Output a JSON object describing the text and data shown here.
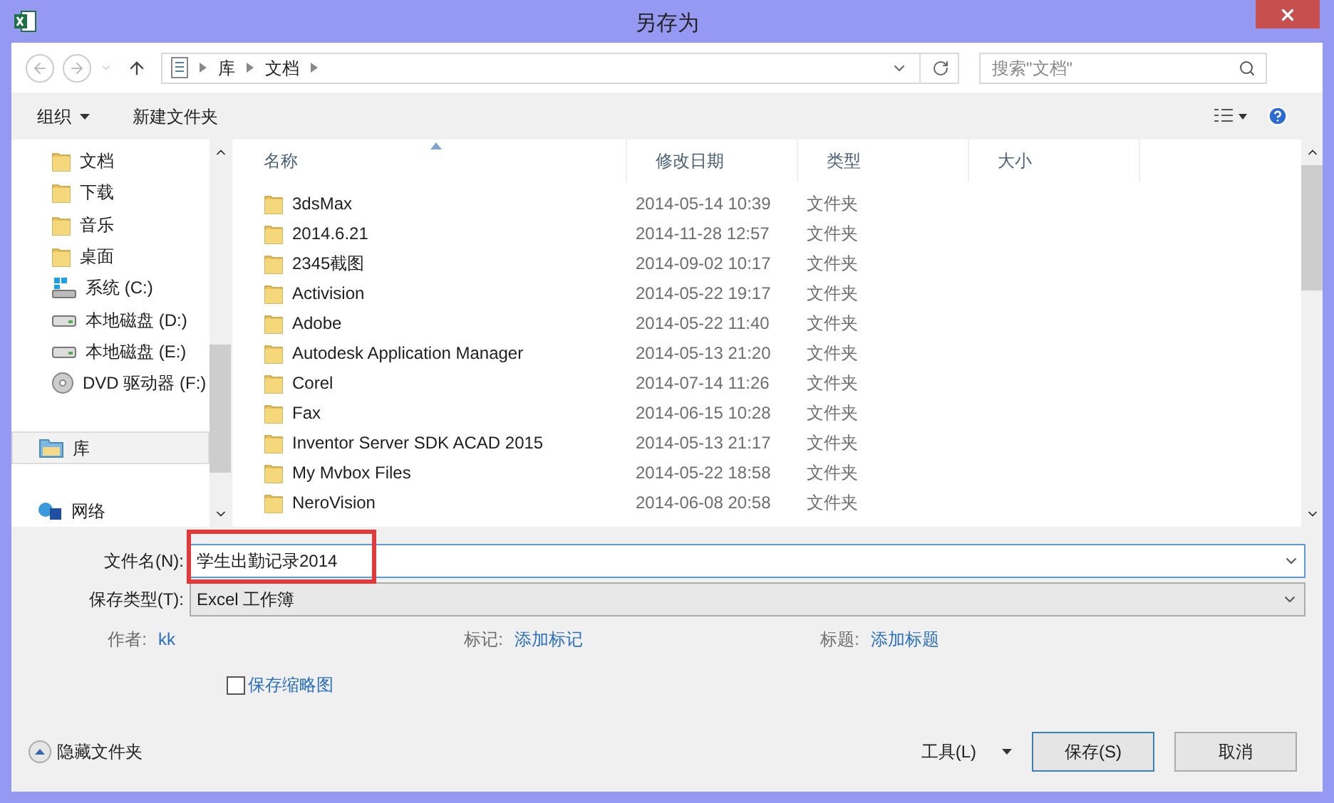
{
  "window": {
    "title": "另存为"
  },
  "address": {
    "breadcrumbs": [
      "库",
      "文档"
    ],
    "search_placeholder": "搜索\"文档\""
  },
  "toolbar": {
    "organize": "组织",
    "new_folder": "新建文件夹"
  },
  "nav": [
    {
      "label": "文档",
      "kind": "folder",
      "selected": false
    },
    {
      "label": "下载",
      "kind": "folder",
      "selected": false
    },
    {
      "label": "音乐",
      "kind": "folder",
      "selected": false
    },
    {
      "label": "桌面",
      "kind": "folder",
      "selected": false
    },
    {
      "label": "系统 (C:)",
      "kind": "system",
      "selected": false
    },
    {
      "label": "本地磁盘 (D:)",
      "kind": "drive",
      "selected": false
    },
    {
      "label": "本地磁盘 (E:)",
      "kind": "drive",
      "selected": false
    },
    {
      "label": "DVD 驱动器 (F:)",
      "kind": "disc",
      "selected": false
    },
    {
      "label": "库",
      "kind": "library",
      "selected": true
    },
    {
      "label": "网络",
      "kind": "network",
      "selected": false
    }
  ],
  "file_list": {
    "columns": [
      {
        "label": "名称",
        "sorted": true
      },
      {
        "label": "修改日期",
        "sorted": false
      },
      {
        "label": "类型",
        "sorted": false
      },
      {
        "label": "大小",
        "sorted": false
      }
    ],
    "rows": [
      {
        "name": "3dsMax",
        "date": "2014-05-14 10:39",
        "type": "文件夹"
      },
      {
        "name": "2014.6.21",
        "date": "2014-11-28 12:57",
        "type": "文件夹"
      },
      {
        "name": "2345截图",
        "date": "2014-09-02 10:17",
        "type": "文件夹"
      },
      {
        "name": "Activision",
        "date": "2014-05-22 19:17",
        "type": "文件夹"
      },
      {
        "name": "Adobe",
        "date": "2014-05-22 11:40",
        "type": "文件夹"
      },
      {
        "name": "Autodesk Application Manager",
        "date": "2014-05-13 21:20",
        "type": "文件夹"
      },
      {
        "name": "Corel",
        "date": "2014-07-14 11:26",
        "type": "文件夹"
      },
      {
        "name": "Fax",
        "date": "2014-06-15 10:28",
        "type": "文件夹"
      },
      {
        "name": "Inventor Server SDK ACAD 2015",
        "date": "2014-05-13 21:17",
        "type": "文件夹"
      },
      {
        "name": "My Mvbox Files",
        "date": "2014-05-22 18:58",
        "type": "文件夹"
      },
      {
        "name": "NeroVision",
        "date": "2014-06-08 20:58",
        "type": "文件夹"
      }
    ]
  },
  "form": {
    "filename_label": "文件名(N):",
    "filename": "学生出勤记录2014",
    "type_label": "保存类型(T):",
    "type": "Excel 工作簿",
    "author_label": "作者:",
    "author": "kk",
    "tags_label": "标记:",
    "tags": "添加标记",
    "title_label": "标题:",
    "title": "添加标题",
    "thumbnail": {
      "label": "保存缩略图",
      "checked": false
    }
  },
  "footer": {
    "hide_folders": "隐藏文件夹",
    "tools": "工具(L)",
    "save": "保存(S)",
    "cancel": "取消"
  }
}
